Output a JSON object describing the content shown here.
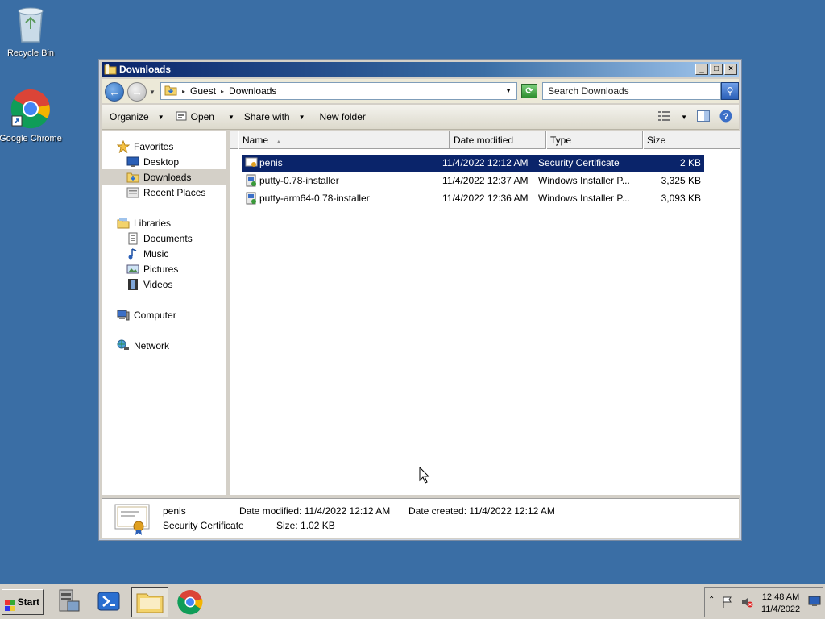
{
  "desktop": {
    "icons": [
      {
        "label": "Recycle Bin",
        "icon": "recycle-bin-icon"
      },
      {
        "label": "Google Chrome",
        "icon": "chrome-icon"
      }
    ]
  },
  "window": {
    "title": "Downloads",
    "controls": {
      "minimize": "_",
      "maximize": "□",
      "close": "×"
    },
    "address": {
      "crumbs": [
        "Guest",
        "Downloads"
      ],
      "search_placeholder": "Search Downloads"
    },
    "toolbar": {
      "organize": "Organize",
      "open": "Open",
      "share_with": "Share with",
      "new_folder": "New folder"
    },
    "nav": {
      "favorites_header": "Favorites",
      "favorites": [
        "Desktop",
        "Downloads",
        "Recent Places"
      ],
      "libraries_header": "Libraries",
      "libraries": [
        "Documents",
        "Music",
        "Pictures",
        "Videos"
      ],
      "computer": "Computer",
      "network": "Network",
      "selected": "Downloads"
    },
    "columns": [
      "Name",
      "Date modified",
      "Type",
      "Size"
    ],
    "files": [
      {
        "name": "penis",
        "date": "11/4/2022 12:12 AM",
        "type": "Security Certificate",
        "size": "2 KB",
        "icon": "certificate-icon",
        "selected": true
      },
      {
        "name": "putty-0.78-installer",
        "date": "11/4/2022 12:37 AM",
        "type": "Windows Installer P...",
        "size": "3,325 KB",
        "icon": "installer-icon",
        "selected": false
      },
      {
        "name": "putty-arm64-0.78-installer",
        "date": "11/4/2022 12:36 AM",
        "type": "Windows Installer P...",
        "size": "3,093 KB",
        "icon": "installer-icon",
        "selected": false
      }
    ],
    "details": {
      "name": "penis",
      "type": "Security Certificate",
      "modified_label": "Date modified:",
      "modified": "11/4/2022 12:12 AM",
      "created_label": "Date created:",
      "created": "11/4/2022 12:12 AM",
      "size_label": "Size:",
      "size": "1.02 KB"
    }
  },
  "taskbar": {
    "start_label": "Start",
    "clock_time": "12:48 AM",
    "clock_date": "11/4/2022"
  },
  "colors": {
    "desktop": "#3a6ea5",
    "selection": "#0a246a",
    "chrome_face": "#d4d0c8"
  }
}
